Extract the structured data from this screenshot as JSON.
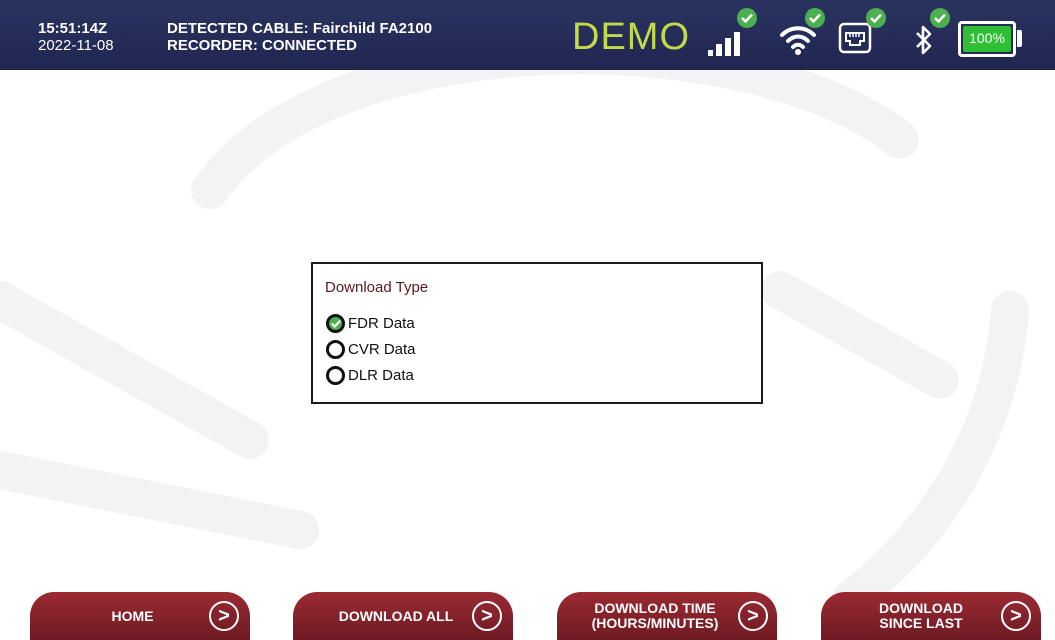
{
  "header": {
    "time": "15:51:14Z",
    "date": "2022-11-08",
    "cable": "DETECTED CABLE: Fairchild FA2100",
    "recorder": "RECORDER: CONNECTED",
    "mode": "DEMO",
    "status_icons": [
      "cellular-signal-icon",
      "wifi-icon",
      "ethernet-icon",
      "bluetooth-icon"
    ],
    "battery_percent": 100,
    "battery_label": "100%"
  },
  "download_panel": {
    "title": "Download Type",
    "options": [
      {
        "label": "FDR Data",
        "selected": true
      },
      {
        "label": "CVR Data",
        "selected": false
      },
      {
        "label": "DLR Data",
        "selected": false
      }
    ]
  },
  "footer": {
    "home": "HOME",
    "download_all": "DOWNLOAD ALL",
    "download_time_line1": "DOWNLOAD TIME",
    "download_time_line2": "(HOURS/MINUTES)",
    "download_since_line1": "DOWNLOAD",
    "download_since_line2": "SINCE LAST",
    "arrow": ">"
  },
  "colors": {
    "header_bg": "#222a55",
    "demo_text": "#c2d94a",
    "check_green": "#4caf50",
    "battery_green": "#2fbf35",
    "button_red": "#8a2430"
  }
}
